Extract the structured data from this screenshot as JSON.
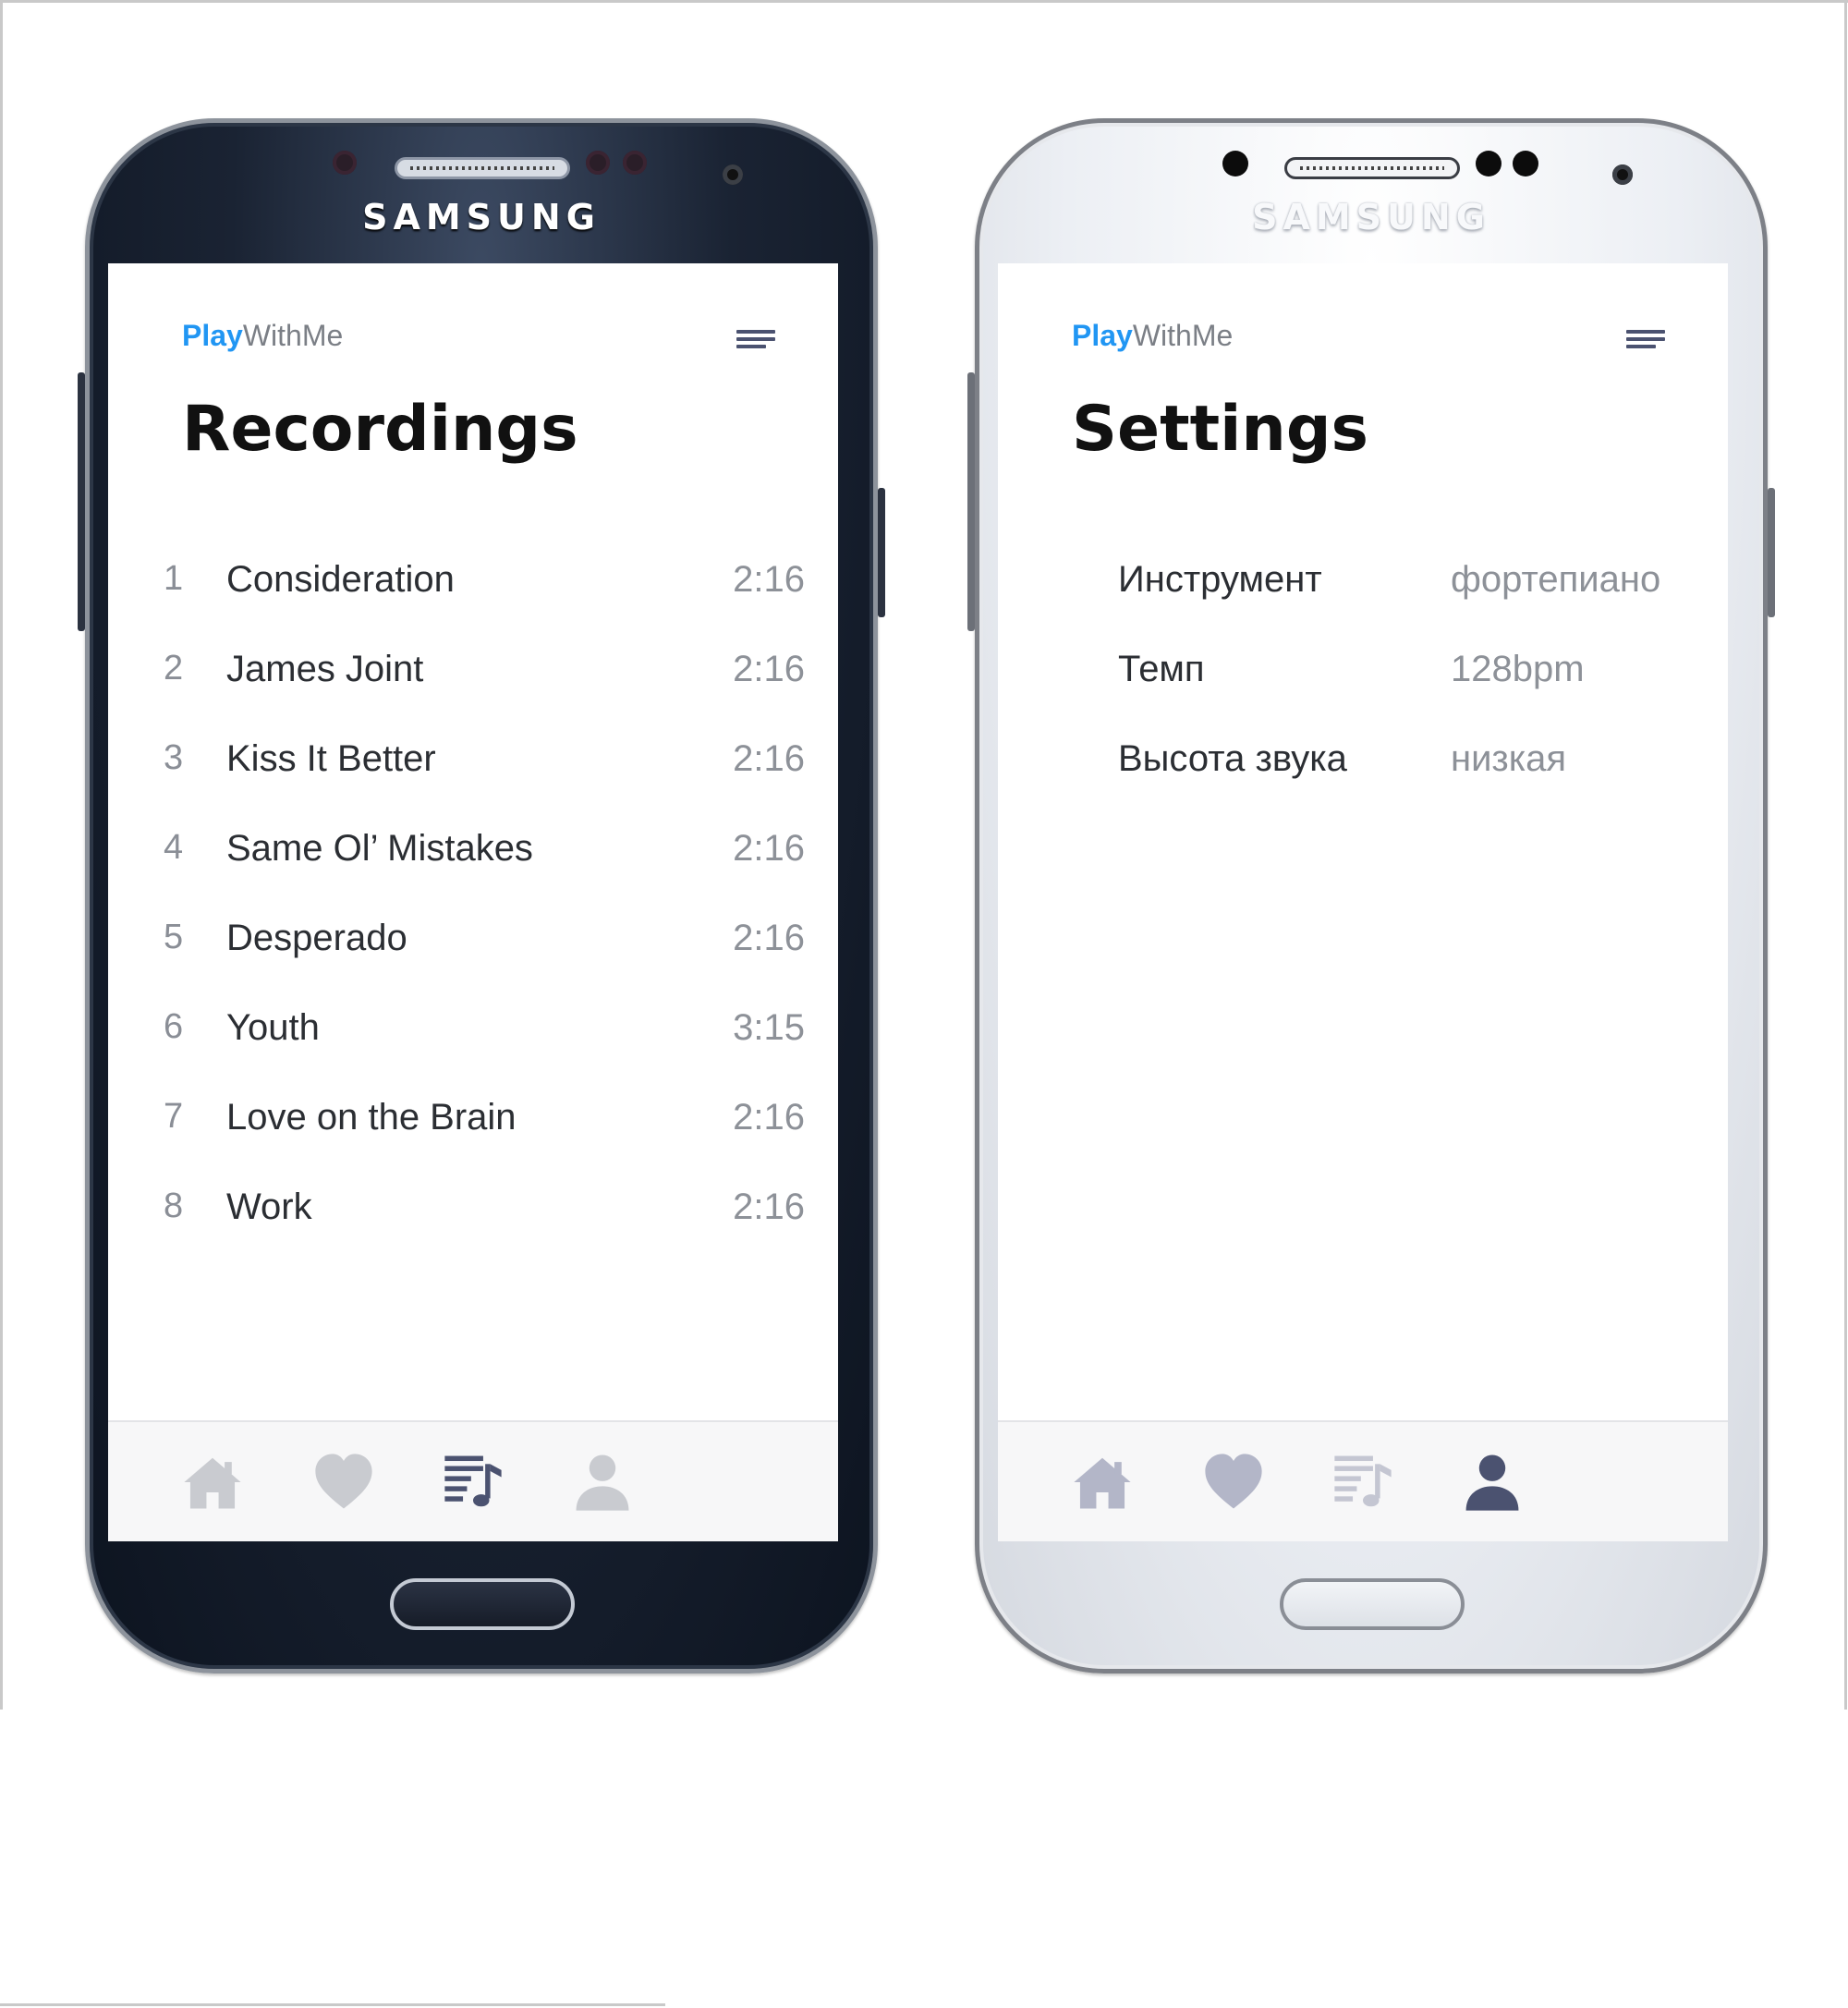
{
  "left_phone": {
    "brand": "SAMSUNG",
    "app": {
      "logo_play": "Play",
      "logo_rest": "WithMe"
    },
    "title": "Recordings",
    "tracks": [
      {
        "num": "1",
        "name": "Consideration",
        "duration": "2:16"
      },
      {
        "num": "2",
        "name": "James Joint",
        "duration": "2:16"
      },
      {
        "num": "3",
        "name": "Kiss It Better",
        "duration": "2:16"
      },
      {
        "num": "4",
        "name": "Same Ol’ Mistakes",
        "duration": "2:16"
      },
      {
        "num": "5",
        "name": "Desperado",
        "duration": "2:16"
      },
      {
        "num": "6",
        "name": "Youth",
        "duration": "3:15"
      },
      {
        "num": "7",
        "name": "Love on the Brain",
        "duration": "2:16"
      },
      {
        "num": "8",
        "name": "Work",
        "duration": "2:16"
      }
    ],
    "nav": [
      {
        "icon": "home-icon",
        "active": false
      },
      {
        "icon": "heart-icon",
        "active": false
      },
      {
        "icon": "playlist-icon",
        "active": true
      },
      {
        "icon": "user-icon",
        "active": false
      }
    ]
  },
  "right_phone": {
    "brand": "SAMSUNG",
    "app": {
      "logo_play": "Play",
      "logo_rest": "WithMe"
    },
    "title": "Settings",
    "settings": [
      {
        "label": "Инструмент",
        "value": "фортепиано"
      },
      {
        "label": "Темп",
        "value": "128bpm"
      },
      {
        "label": "Высота звука",
        "value": "низкая"
      }
    ],
    "nav": [
      {
        "icon": "home-icon",
        "active": false
      },
      {
        "icon": "heart-icon",
        "active": false
      },
      {
        "icon": "playlist-icon",
        "active": false
      },
      {
        "icon": "user-icon",
        "active": true
      }
    ]
  },
  "colors": {
    "brand_blue": "#2196f3",
    "nav_active": "#4b5270",
    "nav_inactive_left": "#c9cbd0",
    "nav_inactive_right": "#b3b6c8"
  }
}
